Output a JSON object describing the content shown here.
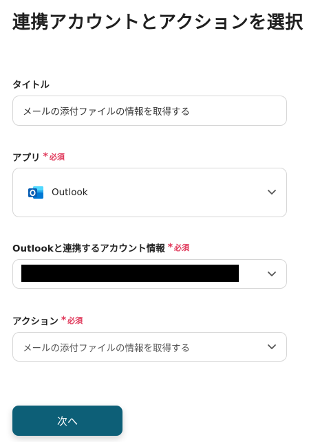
{
  "page": {
    "title": "連携アカウントとアクションを選択"
  },
  "title_field": {
    "label": "タイトル",
    "value": "メールの添付ファイルの情報を取得する"
  },
  "app_field": {
    "label": "アプリ",
    "required_mark": "*",
    "required_text": "必須",
    "selected_app": "Outlook",
    "icon": "outlook-icon"
  },
  "account_field": {
    "label": "Outlookと連携するアカウント情報",
    "required_mark": "*",
    "required_text": "必須"
  },
  "action_field": {
    "label": "アクション",
    "required_mark": "*",
    "required_text": "必須",
    "selected": "メールの添付ファイルの情報を取得する"
  },
  "footer": {
    "next_label": "次へ"
  },
  "colors": {
    "accent": "#0d5f77",
    "required": "#e0395b",
    "border": "#d6d6d6"
  }
}
